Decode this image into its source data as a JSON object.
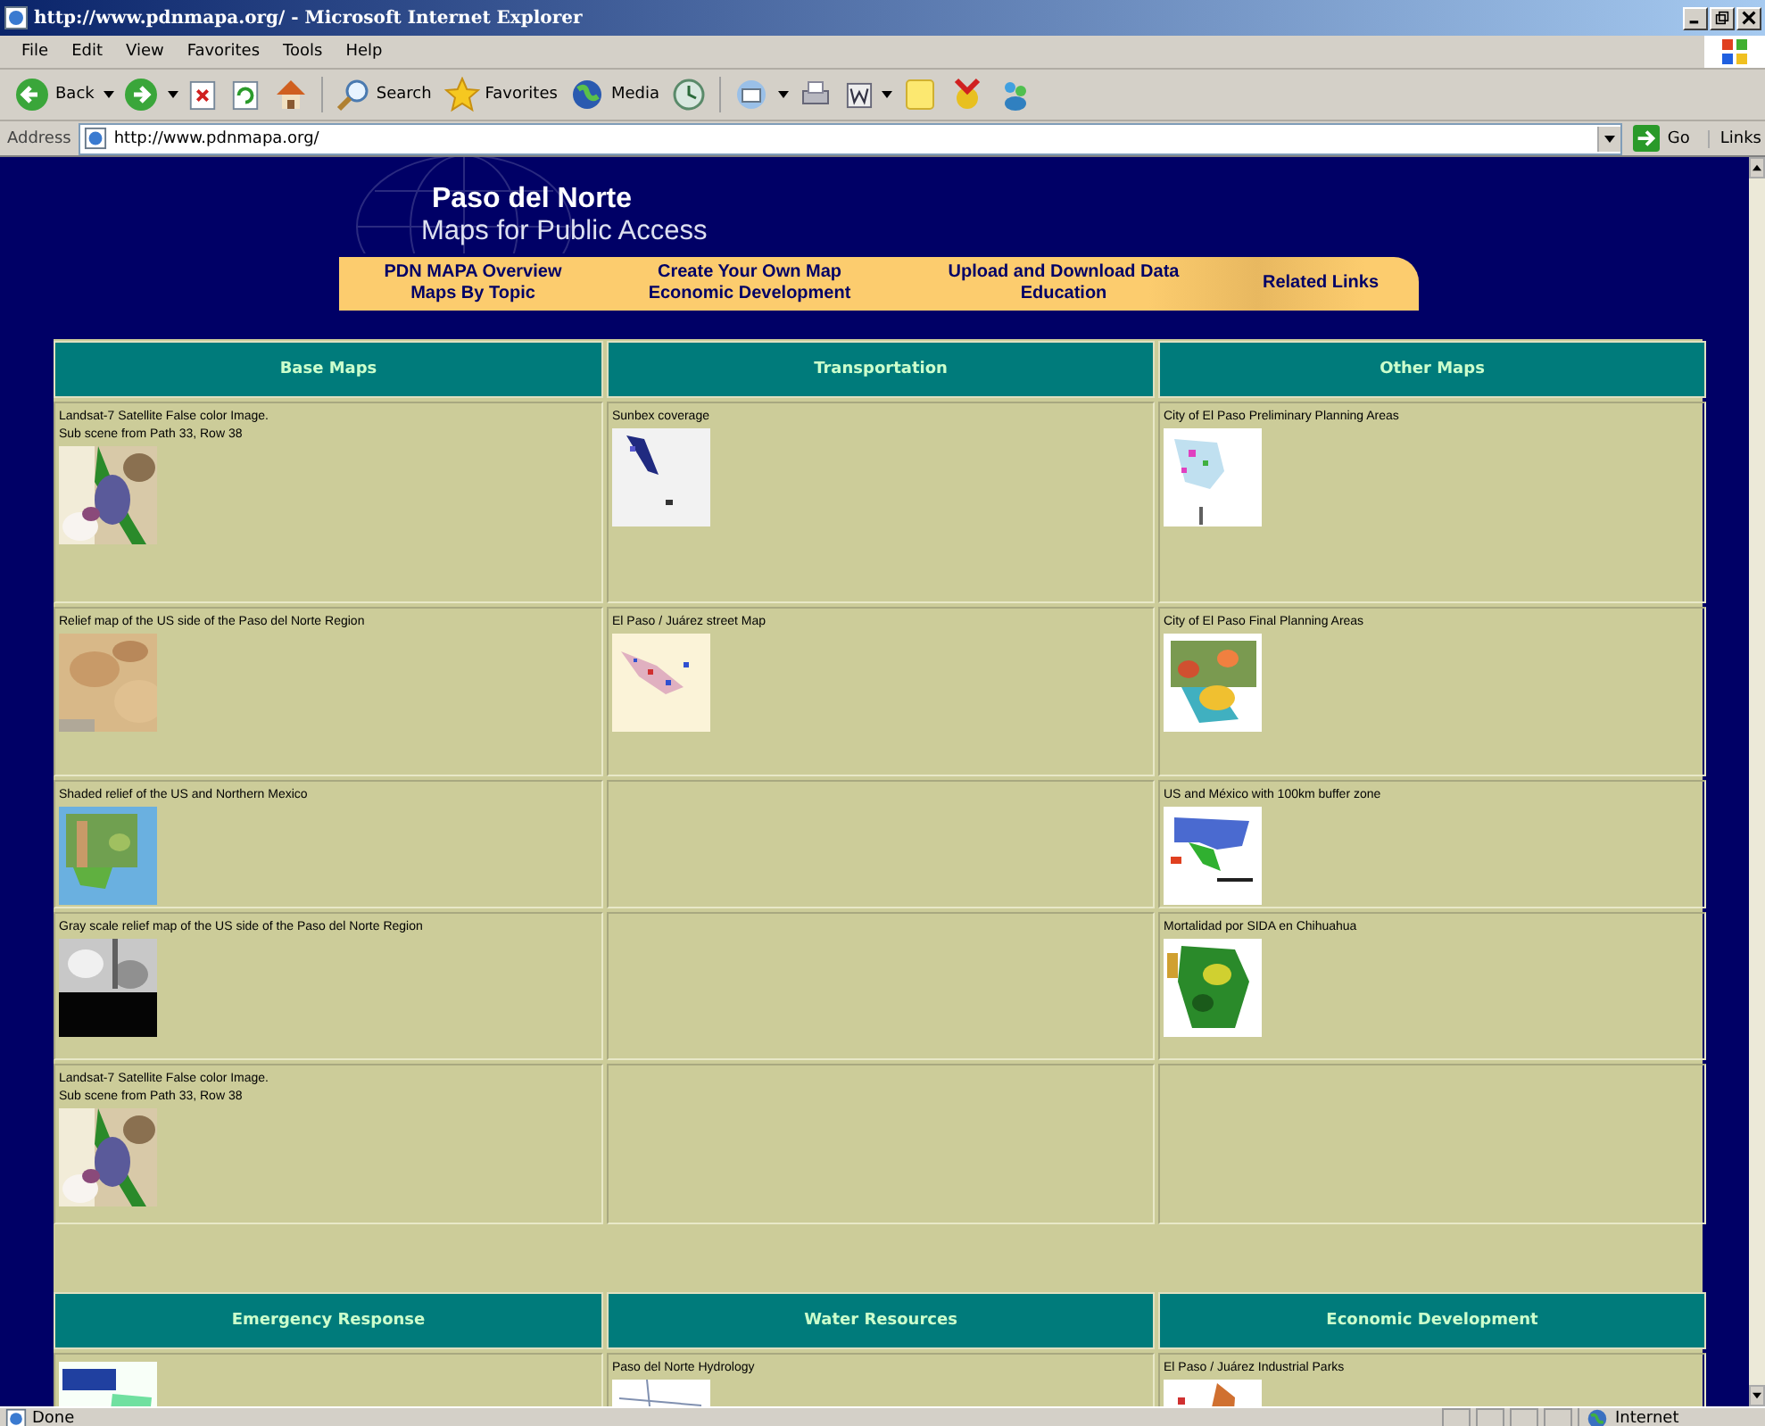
{
  "window": {
    "title": "http://www.pdnmapa.org/ - Microsoft Internet Explorer"
  },
  "menu": [
    {
      "label": "File"
    },
    {
      "label": "Edit"
    },
    {
      "label": "View"
    },
    {
      "label": "Favorites"
    },
    {
      "label": "Tools"
    },
    {
      "label": "Help"
    }
  ],
  "toolbar": {
    "back": "Back",
    "search": "Search",
    "favorites": "Favorites",
    "media": "Media"
  },
  "address": {
    "label": "Address",
    "value": "http://www.pdnmapa.org/",
    "go": "Go",
    "links": "Links"
  },
  "header": {
    "title": "Paso del Norte",
    "subtitle": "Maps for Public Access"
  },
  "nav": [
    {
      "links": [
        "PDN MAPA Overview",
        "Maps By Topic"
      ]
    },
    {
      "links": [
        "Create Your Own Map",
        "Economic Development"
      ]
    },
    {
      "links": [
        "Upload and Download Data",
        "Education"
      ]
    },
    {
      "links": [
        "Related Links"
      ]
    }
  ],
  "sections": [
    {
      "columns": [
        "Base Maps",
        "Transportation",
        "Other Maps"
      ],
      "rows": [
        [
          {
            "kind": "map",
            "caption": [
              "Landsat-7 Satellite False color Image.",
              "Sub scene from Path 33, Row 38"
            ]
          },
          {
            "kind": "map",
            "caption": [
              "Sunbex coverage"
            ]
          },
          {
            "kind": "map",
            "caption": [
              "City of El Paso Preliminary Planning Areas"
            ]
          }
        ],
        [
          {
            "kind": "map",
            "caption": [
              "Relief map of the US side of the Paso del Norte Region"
            ]
          },
          {
            "kind": "map",
            "caption": [
              "El Paso / Juárez street Map"
            ]
          },
          {
            "kind": "map",
            "caption": [
              "City of El Paso Final Planning Areas"
            ]
          }
        ],
        [
          {
            "kind": "map",
            "caption": [
              "Shaded relief of the US and Northern Mexico"
            ]
          },
          {
            "kind": "empty"
          },
          {
            "kind": "map",
            "caption": [
              "US and México with 100km buffer zone"
            ]
          }
        ],
        [
          {
            "kind": "map",
            "caption": [
              "Gray scale relief map of the US side of the Paso del Norte Region"
            ]
          },
          {
            "kind": "empty"
          },
          {
            "kind": "map",
            "caption": [
              "Mortalidad por SIDA en Chihuahua"
            ]
          }
        ],
        [
          {
            "kind": "map",
            "caption": [
              "Landsat-7 Satellite False color Image.",
              "Sub scene from Path 33, Row 38"
            ]
          },
          {
            "kind": "empty"
          },
          {
            "kind": "empty"
          }
        ]
      ]
    },
    {
      "columns": [
        "Emergency Response",
        "Water Resources",
        "Economic Development"
      ],
      "rows": [
        [
          {
            "kind": "map"
          },
          {
            "kind": "map",
            "caption": [
              "Paso del Norte Hydrology"
            ]
          },
          {
            "kind": "map",
            "caption": [
              "El Paso / Juárez Industrial Parks"
            ]
          }
        ]
      ]
    }
  ],
  "status": {
    "text": "Done",
    "zone": "Internet"
  }
}
